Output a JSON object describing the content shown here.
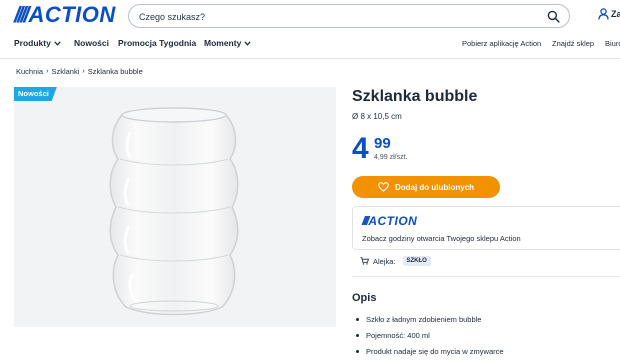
{
  "header": {
    "logo_text": "ACTION",
    "search": {
      "placeholder": "Czego szukasz?"
    },
    "user_text": "Za"
  },
  "nav": {
    "left": [
      {
        "label": "Produkty",
        "has_dropdown": true
      },
      {
        "label": "Nowości",
        "has_dropdown": false
      },
      {
        "label": "Promocja Tygodnia",
        "has_dropdown": false
      },
      {
        "label": "Momenty",
        "has_dropdown": true
      }
    ],
    "right": [
      {
        "label": "Pobierz aplikację Action"
      },
      {
        "label": "Znajdź sklep"
      },
      {
        "label": "Biuro"
      }
    ]
  },
  "breadcrumb": [
    "Kuchnia",
    "Szklanki",
    "Szklanka bubble"
  ],
  "product": {
    "badge": "Nowości",
    "title": "Szklanka bubble",
    "subtitle": "Ø 8 x 10,5 cm",
    "price_int": "4",
    "price_dec": "99",
    "price_unit": "4,99 zł/szt.",
    "favorite_label": "Dodaj do ulubionych"
  },
  "store": {
    "logo_text": "ACTION",
    "link_text": "Zobacz godziny otwarcia Twojego sklepu Action",
    "aisle_label": "Alejka:",
    "aisle_value": "SZKŁO"
  },
  "description": {
    "title": "Opis",
    "items": [
      "Szkło z ładnym zdobieniem bubble",
      "Pojemność: 400 ml",
      "Produkt nadaje się do mycia w zmywarce"
    ]
  },
  "colors": {
    "brand_blue": "#0a4fc4",
    "accent_orange": "#f39200",
    "badge_blue": "#1fa6e3"
  }
}
